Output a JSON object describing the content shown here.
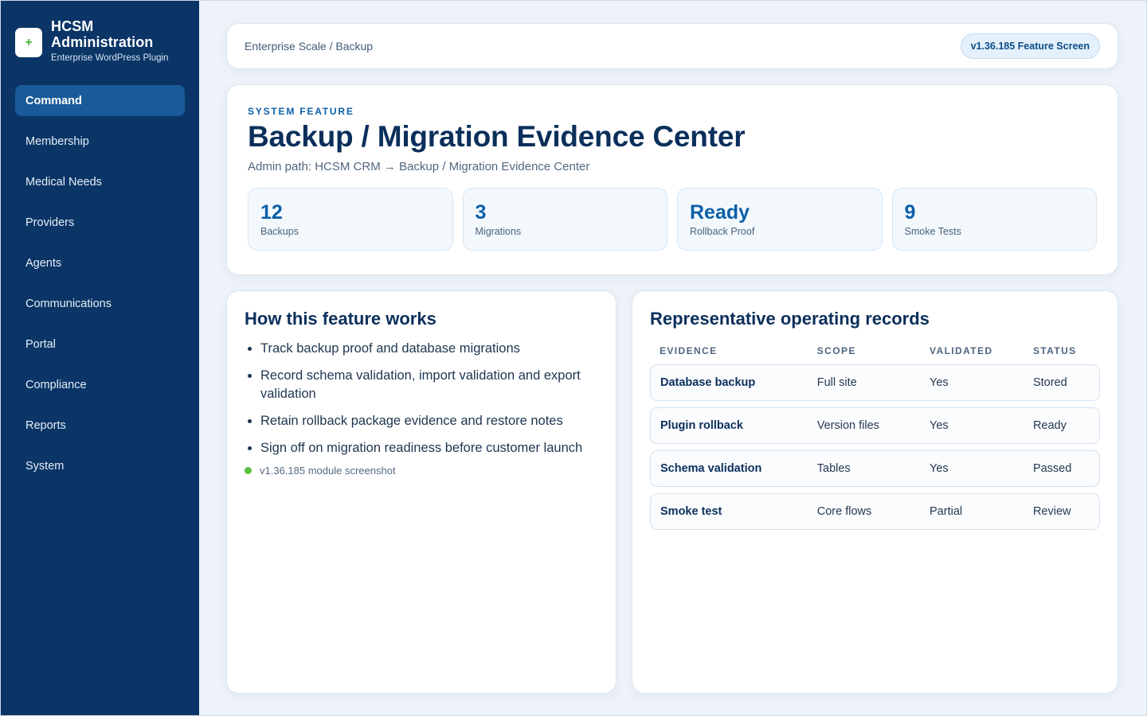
{
  "brand": {
    "logo_glyph": "+",
    "title": "HCSM Administration",
    "subtitle": "Enterprise WordPress Plugin"
  },
  "sidebar": {
    "items": [
      {
        "label": "Command",
        "active": true
      },
      {
        "label": "Membership",
        "active": false
      },
      {
        "label": "Medical Needs",
        "active": false
      },
      {
        "label": "Providers",
        "active": false
      },
      {
        "label": "Agents",
        "active": false
      },
      {
        "label": "Communications",
        "active": false
      },
      {
        "label": "Portal",
        "active": false
      },
      {
        "label": "Compliance",
        "active": false
      },
      {
        "label": "Reports",
        "active": false
      },
      {
        "label": "System",
        "active": false
      }
    ]
  },
  "topbar": {
    "breadcrumb": "Enterprise Scale / Backup",
    "version_badge": "v1.36.185 Feature Screen"
  },
  "hero": {
    "kicker": "SYSTEM FEATURE",
    "title": "Backup / Migration Evidence Center",
    "admin_path": "Admin path: HCSM CRM → Backup / Migration Evidence Center",
    "stats": [
      {
        "value": "12",
        "label": "Backups"
      },
      {
        "value": "3",
        "label": "Migrations"
      },
      {
        "value": "Ready",
        "label": "Rollback Proof"
      },
      {
        "value": "9",
        "label": "Smoke Tests"
      }
    ]
  },
  "how_it_works": {
    "title": "How this feature works",
    "steps": [
      "Track backup proof and database migrations",
      "Record schema validation, import validation and export validation",
      "Retain rollback package evidence and restore notes",
      "Sign off on migration readiness before customer launch"
    ],
    "status_text": "v1.36.185 module screenshot"
  },
  "records": {
    "title": "Representative operating records",
    "columns": [
      "EVIDENCE",
      "SCOPE",
      "VALIDATED",
      "STATUS"
    ],
    "rows": [
      [
        "Database backup",
        "Full site",
        "Yes",
        "Stored"
      ],
      [
        "Plugin rollback",
        "Version files",
        "Yes",
        "Ready"
      ],
      [
        "Schema validation",
        "Tables",
        "Yes",
        "Passed"
      ],
      [
        "Smoke test",
        "Core flows",
        "Partial",
        "Review"
      ]
    ]
  },
  "colors": {
    "sidebar_bg": "#0a3566",
    "active_nav": "#1a5a98",
    "accent": "#0b5fa8",
    "status_dot": "#5bbf3f"
  }
}
